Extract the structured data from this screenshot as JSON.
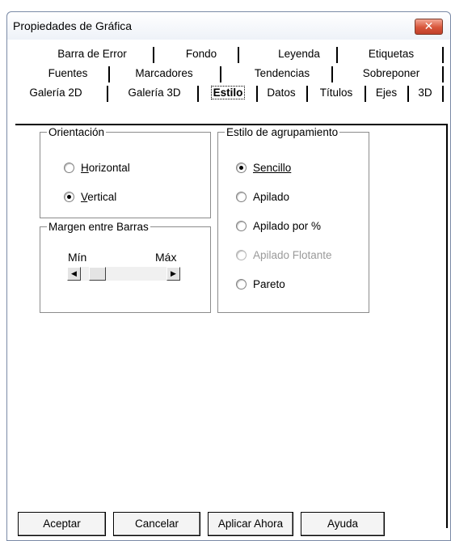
{
  "window": {
    "title": "Propiedades de Gráfica",
    "close_glyph": "✕"
  },
  "tabs": {
    "row1": [
      "Barra de Error",
      "Fondo",
      "Leyenda",
      "Etiquetas"
    ],
    "row2": [
      "Fuentes",
      "Marcadores",
      "Tendencias",
      "Sobreponer"
    ],
    "row3": [
      "Galería 2D",
      "Galería 3D",
      "Estilo",
      "Datos",
      "Títulos",
      "Ejes",
      "3D"
    ],
    "active": "Estilo"
  },
  "orientacion": {
    "legend": "Orientación",
    "options": [
      {
        "label": "Horizontal",
        "checked": false
      },
      {
        "label": "Vertical",
        "checked": true
      }
    ]
  },
  "margen": {
    "legend": "Margen entre Barras",
    "min_label": "Mín",
    "max_label": "Máx",
    "value_fraction": 0.12
  },
  "agrupamiento": {
    "legend": "Estilo de agrupamiento",
    "options": [
      {
        "label": "Sencillo",
        "checked": true,
        "disabled": false
      },
      {
        "label": "Apilado",
        "checked": false,
        "disabled": false
      },
      {
        "label": "Apilado por %",
        "checked": false,
        "disabled": false
      },
      {
        "label": "Apilado Flotante",
        "checked": false,
        "disabled": true
      },
      {
        "label": "Pareto",
        "checked": false,
        "disabled": false
      }
    ]
  },
  "buttons": {
    "aceptar": "Aceptar",
    "cancelar": "Cancelar",
    "aplicar": "Aplicar Ahora",
    "ayuda": "Ayuda"
  },
  "colors": {
    "close_button": "#d8553a",
    "window_border": "#7a8aa6"
  }
}
